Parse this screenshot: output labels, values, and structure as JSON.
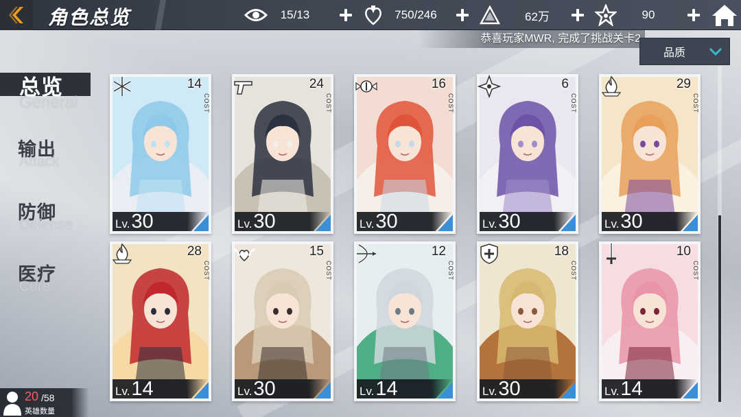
{
  "header": {
    "title": "角色总览",
    "resources": [
      {
        "icon": "eye-icon",
        "value": "15/13"
      },
      {
        "icon": "heart-potion-icon",
        "value": "750/246"
      },
      {
        "icon": "crystal-icon",
        "value": "62万"
      },
      {
        "icon": "star-gem-icon",
        "value": "90"
      }
    ]
  },
  "notice": "恭喜玩家MWR, 完成了挑战关卡2",
  "sort": {
    "label": "品质"
  },
  "categories": [
    {
      "zh": "总览",
      "en": "General"
    },
    {
      "zh": "输出",
      "en": "Attack"
    },
    {
      "zh": "防御",
      "en": "Defense"
    },
    {
      "zh": "医疗",
      "en": "Cure"
    }
  ],
  "cards": [
    {
      "cost": "14",
      "level": "30",
      "class_icon": "snowflake-icon",
      "cost_label": "COST",
      "lv_label": "Lv."
    },
    {
      "cost": "24",
      "level": "30",
      "class_icon": "pistol-icon",
      "cost_label": "COST",
      "lv_label": "Lv."
    },
    {
      "cost": "16",
      "level": "30",
      "class_icon": "winged-emblem-icon",
      "cost_label": "COST",
      "lv_label": "Lv."
    },
    {
      "cost": "6",
      "level": "30",
      "class_icon": "shuriken-icon",
      "cost_label": "COST",
      "lv_label": "Lv."
    },
    {
      "cost": "29",
      "level": "30",
      "class_icon": "flame-emblem-icon",
      "cost_label": "COST",
      "lv_label": "Lv."
    },
    {
      "cost": "28",
      "level": "14",
      "class_icon": "flame-emblem-icon",
      "cost_label": "COST",
      "lv_label": "Lv."
    },
    {
      "cost": "15",
      "level": "30",
      "class_icon": "heart-wings-icon",
      "cost_label": "COST",
      "lv_label": "Lv."
    },
    {
      "cost": "12",
      "level": "14",
      "class_icon": "bow-icon",
      "cost_label": "COST",
      "lv_label": "Lv."
    },
    {
      "cost": "18",
      "level": "30",
      "class_icon": "shield-cross-icon",
      "cost_label": "COST",
      "lv_label": "Lv."
    },
    {
      "cost": "10",
      "level": "14",
      "class_icon": "sword-icon",
      "cost_label": "COST",
      "lv_label": "Lv."
    }
  ],
  "hero_count": {
    "current": "20",
    "max": "/58",
    "label": "英雄数量"
  },
  "colors": {
    "accent_blue": "#3a8fd6",
    "hero_count_red": "#ff5b63",
    "back_orange": "#f29a1b"
  }
}
